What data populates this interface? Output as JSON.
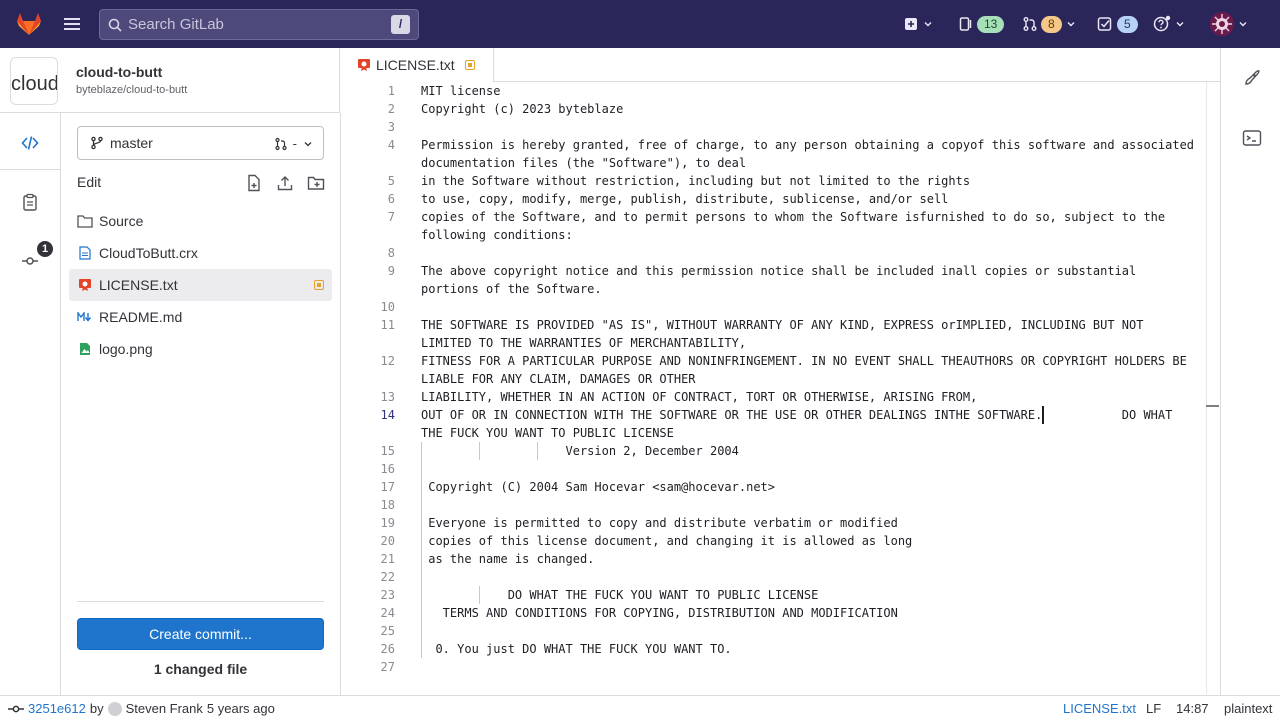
{
  "topbar": {
    "search_placeholder": "Search GitLab",
    "search_shortcut": "/",
    "issues_count": "13",
    "merge_requests_count": "8",
    "todos_count": "5"
  },
  "project": {
    "avatar_text": "cloud",
    "name": "cloud-to-butt",
    "path": "byteblaze/cloud-to-butt"
  },
  "sidebar": {
    "rail_badge": "1",
    "branch": "master",
    "branch_right": "-",
    "edit_label": "Edit",
    "files": [
      {
        "name": "Source",
        "type": "folder"
      },
      {
        "name": "CloudToButt.crx",
        "type": "file"
      },
      {
        "name": "LICENSE.txt",
        "type": "license",
        "active": true
      },
      {
        "name": "README.md",
        "type": "markdown"
      },
      {
        "name": "logo.png",
        "type": "image"
      }
    ],
    "commit_button": "Create commit...",
    "changed_files": "1 changed file"
  },
  "editor": {
    "tab_name": "LICENSE.txt",
    "lines": [
      {
        "n": "1",
        "text": "MIT license"
      },
      {
        "n": "2",
        "text": "Copyright (c) 2023 byteblaze"
      },
      {
        "n": "3",
        "text": ""
      },
      {
        "n": "4",
        "text": "Permission is hereby granted, free of charge, to any person obtaining a copyof this software and associated"
      },
      {
        "n": "",
        "text": "documentation files (the \"Software\"), to deal"
      },
      {
        "n": "5",
        "text": "in the Software without restriction, including but not limited to the rights"
      },
      {
        "n": "6",
        "text": "to use, copy, modify, merge, publish, distribute, sublicense, and/or sell"
      },
      {
        "n": "7",
        "text": "copies of the Software, and to permit persons to whom the Software isfurnished to do so, subject to the"
      },
      {
        "n": "",
        "text": "following conditions:"
      },
      {
        "n": "8",
        "text": ""
      },
      {
        "n": "9",
        "text": "The above copyright notice and this permission notice shall be included inall copies or substantial"
      },
      {
        "n": "",
        "text": "portions of the Software."
      },
      {
        "n": "10",
        "text": ""
      },
      {
        "n": "11",
        "text": "THE SOFTWARE IS PROVIDED \"AS IS\", WITHOUT WARRANTY OF ANY KIND, EXPRESS orIMPLIED, INCLUDING BUT NOT"
      },
      {
        "n": "",
        "text": "LIMITED TO THE WARRANTIES OF MERCHANTABILITY,"
      },
      {
        "n": "12",
        "text": "FITNESS FOR A PARTICULAR PURPOSE AND NONINFRINGEMENT. IN NO EVENT SHALL THEAUTHORS OR COPYRIGHT HOLDERS BE"
      },
      {
        "n": "",
        "text": "LIABLE FOR ANY CLAIM, DAMAGES OR OTHER"
      },
      {
        "n": "13",
        "text": "LIABILITY, WHETHER IN AN ACTION OF CONTRACT, TORT OR OTHERWISE, ARISING FROM,"
      },
      {
        "n": "14",
        "text": "OUT OF OR IN CONNECTION WITH THE SOFTWARE OR THE USE OR OTHER DEALINGS INTHE SOFTWARE.           DO WHAT",
        "current": true
      },
      {
        "n": "",
        "text": "THE FUCK YOU WANT TO PUBLIC LICENSE"
      },
      {
        "n": "15",
        "text": "                    Version 2, December 2004"
      },
      {
        "n": "16",
        "text": ""
      },
      {
        "n": "17",
        "text": " Copyright (C) 2004 Sam Hocevar <sam@hocevar.net>"
      },
      {
        "n": "18",
        "text": ""
      },
      {
        "n": "19",
        "text": " Everyone is permitted to copy and distribute verbatim or modified"
      },
      {
        "n": "20",
        "text": " copies of this license document, and changing it is allowed as long"
      },
      {
        "n": "21",
        "text": " as the name is changed."
      },
      {
        "n": "22",
        "text": ""
      },
      {
        "n": "23",
        "text": "            DO WHAT THE FUCK YOU WANT TO PUBLIC LICENSE"
      },
      {
        "n": "24",
        "text": "   TERMS AND CONDITIONS FOR COPYING, DISTRIBUTION AND MODIFICATION"
      },
      {
        "n": "25",
        "text": ""
      },
      {
        "n": "26",
        "text": "  0. You just DO WHAT THE FUCK YOU WANT TO."
      },
      {
        "n": "27",
        "text": ""
      }
    ]
  },
  "statusbar": {
    "commit_sha": "3251e612",
    "by": "by",
    "author": "Steven Frank",
    "time": "5 years ago",
    "file": "LICENSE.txt",
    "eol": "LF",
    "position": "14:87",
    "language": "plaintext"
  },
  "colors": {
    "topbar": "#2b2659",
    "accent": "#1f75cb",
    "modified": "#e9a128"
  }
}
